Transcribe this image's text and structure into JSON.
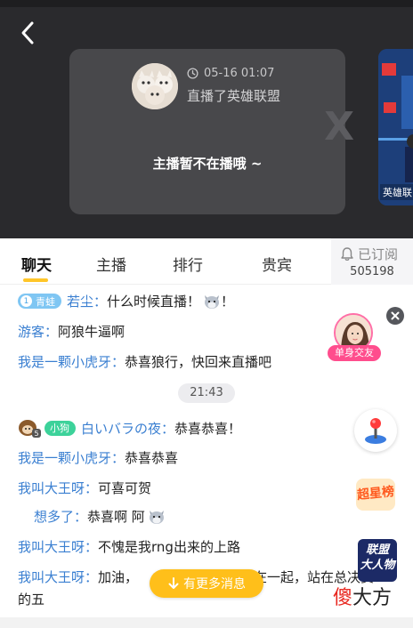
{
  "card": {
    "time": "05-16 01:07",
    "action": "直播了英雄联盟",
    "offline_text": "主播暂不在播哦 ~",
    "watermark": "X"
  },
  "recommend": {
    "label": "英雄联"
  },
  "tabs": [
    {
      "label": "聊天",
      "active": true
    },
    {
      "label": "主播",
      "active": false
    },
    {
      "label": "排行",
      "active": false
    },
    {
      "label": "贵宾",
      "active": false
    }
  ],
  "subscribe": {
    "label": "已订阅",
    "count": "505198"
  },
  "chat": {
    "messages": [
      {
        "badge_level": "1",
        "badge_name": "青蛙",
        "user": "若尘：",
        "text": "什么时候直播！",
        "suffix": "！"
      },
      {
        "user": "游客：",
        "text": "阿狼牛逼啊"
      },
      {
        "user": "我是一颗小虎牙：",
        "text": "恭喜狼行，快回来直播吧"
      },
      {
        "badge_name": "小狗",
        "badge_level": "5",
        "user": "白いバラの夜：",
        "text": "恭喜恭喜！"
      },
      {
        "user": "我是一颗小虎牙：",
        "text": "恭喜恭喜"
      },
      {
        "user": "我叫大王呀：",
        "text": "可喜可贺"
      },
      {
        "user": "想多了：",
        "text": "恭喜啊 阿"
      },
      {
        "user": "我叫大王呀：",
        "text": "不愧是我rng出来的上路"
      },
      {
        "user": "我叫大王呀：",
        "text": "加油，",
        "text_tail": "在一起，站在总决赛",
        "line2": "的五"
      }
    ],
    "time_divider": "21:43"
  },
  "widgets": {
    "single_label": "单身交友",
    "super_label": "超星榜",
    "league_label": [
      "联盟",
      "大人物"
    ]
  },
  "more_messages": "有更多消息",
  "watermark": {
    "part1": "傻",
    "part2": "大方"
  },
  "colors": {
    "accent": "#ffc629",
    "username": "#3a7fd1",
    "more_button": "#ffbf1a",
    "pink": "#ff4d8d"
  },
  "icons": [
    "back-arrow-icon",
    "clock-icon",
    "bell-icon",
    "close-icon",
    "arrow-down-icon",
    "fox-emoji-icon",
    "joystick-icon"
  ]
}
